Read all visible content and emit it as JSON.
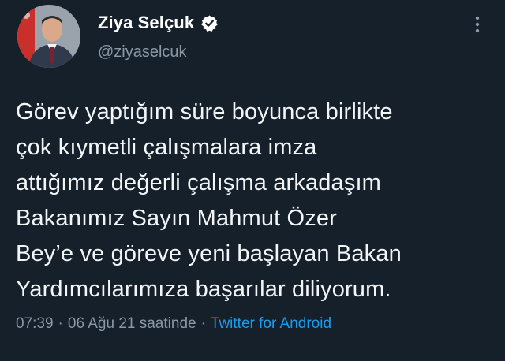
{
  "author": {
    "display_name": "Ziya Selçuk",
    "handle": "@ziyaselcuk",
    "verified": true
  },
  "icons": {
    "verified": "verified-badge-icon",
    "more": "more-vertical-icon",
    "avatar": "profile-photo"
  },
  "tweet": {
    "text": "Görev yaptığım süre boyunca birlikte\nçok kıymetli çalışmalara imza\nattığımız değerli çalışma arkadaşım\nBakanımız Sayın Mahmut Özer\nBey’e ve göreve yeni başlayan Bakan\nYardımcılarımıza  başarılar diliyorum.",
    "time": "07:39",
    "date": "06 Ağu 21 saatinde",
    "separator": "·",
    "source": "Twitter for Android"
  },
  "colors": {
    "background": "#15202b",
    "text": "#ffffff",
    "muted": "#8b98a5",
    "accent": "#1d9bf0"
  }
}
